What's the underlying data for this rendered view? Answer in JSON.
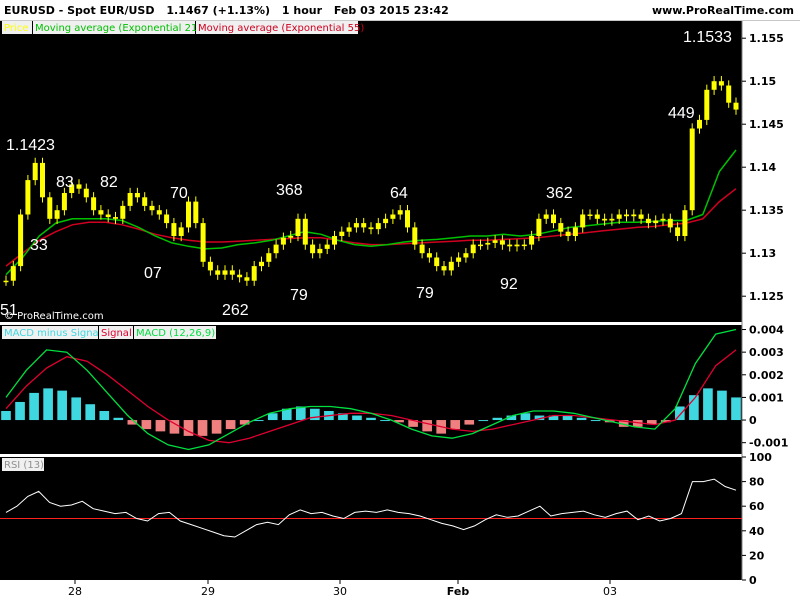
{
  "header": {
    "symbol": "EURUSD - Spot EUR/USD",
    "price": "1.1467 (+1.13%)",
    "interval": "1 hour",
    "datetime": "Feb 03 2015 23:42",
    "site": "www.ProRealTime.com"
  },
  "colors": {
    "background": "#000000",
    "price": "#ffff00",
    "ema21": "#00c000",
    "ema55": "#d00020",
    "histogram_pos": "#40d8e0",
    "histogram_neg": "#f08080",
    "macd_line": "#00e040",
    "signal_line": "#e00030",
    "rsi_line": "#ffffff",
    "rsi_level": "#ff2020"
  },
  "chart_data": [
    {
      "type": "candlestick",
      "panel": "price",
      "legend": [
        {
          "name": "Price",
          "color": "#ffff00"
        },
        {
          "name": "Moving average (Exponential 21)",
          "color": "#00c000"
        },
        {
          "name": "Moving average (Exponential 55)",
          "color": "#d00020"
        }
      ],
      "ylim": [
        1.122,
        1.157
      ],
      "y_ticks": [
        "1.155",
        "1.15",
        "1.145",
        "1.14",
        "1.135",
        "1.13",
        "1.125"
      ],
      "x_ticks": [
        "28",
        "29",
        "30",
        "Feb",
        "03"
      ],
      "series": [
        {
          "name": "Price",
          "values": [
            1.1268,
            1.1285,
            1.1345,
            1.1385,
            1.1405,
            1.1365,
            1.134,
            1.135,
            1.137,
            1.138,
            1.1375,
            1.1365,
            1.135,
            1.1345,
            1.1342,
            1.134,
            1.1355,
            1.137,
            1.1365,
            1.1355,
            1.135,
            1.1345,
            1.1335,
            1.132,
            1.133,
            1.136,
            1.1335,
            1.129,
            1.128,
            1.1275,
            1.128,
            1.1275,
            1.1272,
            1.1268,
            1.1285,
            1.129,
            1.13,
            1.131,
            1.1318,
            1.132,
            1.134,
            1.131,
            1.13,
            1.1305,
            1.131,
            1.132,
            1.1325,
            1.133,
            1.1335,
            1.133,
            1.1328,
            1.1335,
            1.134,
            1.1345,
            1.135,
            1.133,
            1.131,
            1.13,
            1.1295,
            1.1285,
            1.128,
            1.129,
            1.1295,
            1.13,
            1.131,
            1.131,
            1.1312,
            1.1315,
            1.131,
            1.1308,
            1.131,
            1.131,
            1.132,
            1.134,
            1.1345,
            1.1335,
            1.1325,
            1.132,
            1.133,
            1.1345,
            1.1345,
            1.134,
            1.1338,
            1.134,
            1.1345,
            1.1343,
            1.1345,
            1.134,
            1.1335,
            1.1338,
            1.134,
            1.133,
            1.132,
            1.135,
            1.1445,
            1.1455,
            1.149,
            1.15,
            1.1495,
            1.1475,
            1.1467
          ]
        },
        {
          "name": "Moving average (Exponential 21)",
          "values": [
            1.1275,
            1.1295,
            1.132,
            1.1335,
            1.134,
            1.134,
            1.134,
            1.1338,
            1.133,
            1.132,
            1.1312,
            1.1308,
            1.1305,
            1.1306,
            1.131,
            1.1312,
            1.1315,
            1.132,
            1.1325,
            1.1322,
            1.1315,
            1.131,
            1.1308,
            1.131,
            1.1313,
            1.1315,
            1.1316,
            1.1318,
            1.132,
            1.132,
            1.1322,
            1.132,
            1.1322,
            1.1326,
            1.133,
            1.1332,
            1.1334,
            1.1336,
            1.1336,
            1.1337,
            1.1338,
            1.1338,
            1.1345,
            1.1395,
            1.142
          ]
        },
        {
          "name": "Moving average (Exponential 55)",
          "values": [
            1.1285,
            1.13,
            1.1315,
            1.1325,
            1.1333,
            1.1336,
            1.1336,
            1.1333,
            1.1328,
            1.1322,
            1.1318,
            1.1315,
            1.1313,
            1.1313,
            1.1314,
            1.1315,
            1.1316,
            1.1317,
            1.1318,
            1.1318,
            1.1315,
            1.1312,
            1.131,
            1.131,
            1.1311,
            1.1312,
            1.1313,
            1.1314,
            1.1315,
            1.1315,
            1.1316,
            1.1317,
            1.1318,
            1.132,
            1.1322,
            1.1324,
            1.1326,
            1.1328,
            1.133,
            1.1331,
            1.1333,
            1.1335,
            1.134,
            1.136,
            1.1375
          ]
        }
      ],
      "annotations": [
        "1.1423",
        "33",
        "83",
        "82",
        "07",
        "70",
        "262",
        "368",
        "79",
        "64",
        "79",
        "92",
        "362",
        "449",
        "1.1533",
        "51"
      ],
      "watermark": "© ProRealTime.com"
    },
    {
      "type": "bar",
      "panel": "macd",
      "legend": [
        {
          "name": "MACD minus Signal",
          "color": "#40d8e0"
        },
        {
          "name": "Signal",
          "color": "#e00030"
        },
        {
          "name": "MACD (12,26,9)",
          "color": "#00e040"
        }
      ],
      "ylim": [
        -0.0015,
        0.0042
      ],
      "y_ticks": [
        "0.004",
        "0.003",
        "0.002",
        "0.001",
        "0",
        "-0.001"
      ],
      "series": [
        {
          "name": "MACD minus Signal",
          "values": [
            0.0004,
            0.0008,
            0.0012,
            0.0014,
            0.0013,
            0.001,
            0.0007,
            0.0004,
            0.0001,
            -0.0002,
            -0.0004,
            -0.0005,
            -0.0006,
            -0.0007,
            -0.0007,
            -0.0006,
            -0.0004,
            -0.0002,
            0.0,
            0.0003,
            0.0005,
            0.0006,
            0.0005,
            0.0004,
            0.0003,
            0.0002,
            0.0001,
            0.0,
            -0.0001,
            -0.0003,
            -0.0005,
            -0.0006,
            -0.0004,
            -0.0002,
            0.0,
            0.0001,
            0.0002,
            0.0003,
            0.0002,
            0.0002,
            0.0002,
            0.0001,
            0.0,
            -0.0001,
            -0.0003,
            -0.0003,
            -0.0002,
            -0.0001,
            0.0006,
            0.0011,
            0.0014,
            0.0013,
            0.001
          ]
        },
        {
          "name": "Signal",
          "values": [
            0.0005,
            0.0015,
            0.0023,
            0.0028,
            0.0026,
            0.002,
            0.0013,
            0.0006,
            0.0,
            -0.0005,
            -0.0009,
            -0.001,
            -0.0008,
            -0.0005,
            -0.0002,
            0.0001,
            0.0002,
            0.0003,
            0.0003,
            0.0002,
            0.0,
            -0.0002,
            -0.0004,
            -0.0005,
            -0.0004,
            -0.0002,
            0.0,
            0.0002,
            0.0002,
            0.0001,
            0.0,
            -0.0001,
            -0.0002,
            0.0,
            0.001,
            0.0024,
            0.0031
          ]
        },
        {
          "name": "MACD (12,26,9)",
          "values": [
            0.001,
            0.0022,
            0.0031,
            0.003,
            0.0022,
            0.0012,
            0.0002,
            -0.0006,
            -0.0011,
            -0.0013,
            -0.0011,
            -0.0006,
            -0.0001,
            0.0003,
            0.0005,
            0.0006,
            0.0006,
            0.0005,
            0.0003,
            0.0,
            -0.0004,
            -0.0007,
            -0.0008,
            -0.0006,
            -0.0002,
            0.0002,
            0.0004,
            0.0004,
            0.0003,
            0.0001,
            -0.0001,
            -0.0003,
            -0.0004,
            0.0005,
            0.0025,
            0.0038,
            0.004
          ]
        }
      ]
    },
    {
      "type": "line",
      "panel": "rsi",
      "legend": [
        {
          "name": "RSI (13)",
          "color": "#ffffff"
        }
      ],
      "ylim": [
        0,
        100
      ],
      "y_ticks": [
        "100",
        "80",
        "60",
        "40",
        "20",
        "0"
      ],
      "reference_level": 50,
      "series": [
        {
          "name": "RSI (13)",
          "values": [
            55,
            60,
            68,
            72,
            63,
            60,
            61,
            64,
            58,
            56,
            54,
            55,
            50,
            48,
            54,
            55,
            48,
            45,
            42,
            39,
            36,
            35,
            40,
            45,
            47,
            45,
            53,
            57,
            54,
            55,
            52,
            50,
            55,
            56,
            55,
            57,
            55,
            54,
            52,
            49,
            46,
            44,
            41,
            44,
            49,
            53,
            51,
            52,
            56,
            60,
            52,
            54,
            55,
            56,
            53,
            51,
            54,
            56,
            49,
            52,
            48,
            50,
            54,
            80,
            80,
            82,
            76,
            73
          ]
        }
      ]
    }
  ]
}
